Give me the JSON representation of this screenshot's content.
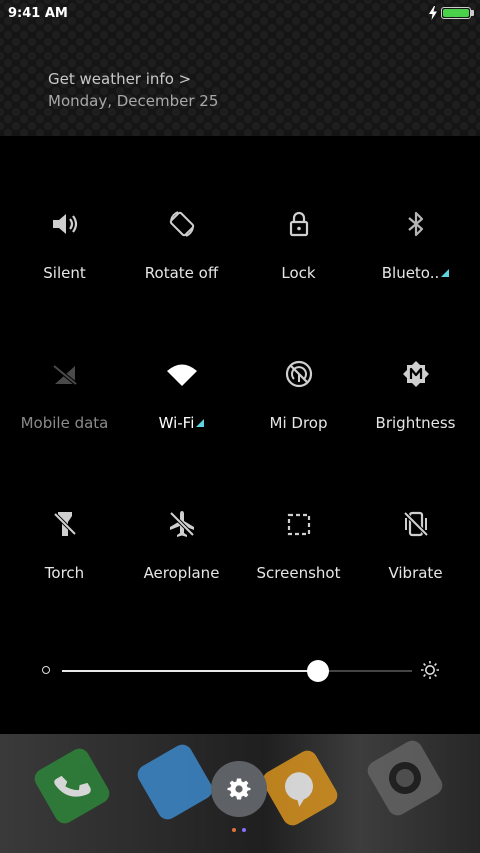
{
  "status_bar": {
    "time": "9:41 AM",
    "battery_level": 1.0
  },
  "header": {
    "weather_link": "Get weather info >",
    "date": "Monday, December 25"
  },
  "toggles": [
    {
      "label": "Silent",
      "icon": "speaker-icon"
    },
    {
      "label": "Rotate off",
      "icon": "rotate-icon"
    },
    {
      "label": "Lock",
      "icon": "lock-icon"
    },
    {
      "label": "Blueto..",
      "icon": "bluetooth-icon",
      "has_submenu": true
    },
    {
      "label": "Mobile data",
      "icon": "mobile-data-off-icon",
      "disabled": true
    },
    {
      "label": "Wi-Fi",
      "icon": "wifi-icon",
      "active": true,
      "has_submenu": true
    },
    {
      "label": "Mi Drop",
      "icon": "mi-drop-icon"
    },
    {
      "label": "Brightness",
      "icon": "auto-brightness-icon"
    },
    {
      "label": "Torch",
      "icon": "torch-icon"
    },
    {
      "label": "Aeroplane",
      "icon": "airplane-icon"
    },
    {
      "label": "Screenshot",
      "icon": "screenshot-icon"
    },
    {
      "label": "Vibrate",
      "icon": "vibrate-icon"
    }
  ],
  "brightness": {
    "level": 0.73
  },
  "colors": {
    "background": "#000000",
    "submenu_indicator": "#5fd3e0",
    "battery": "#4bd24b",
    "settings_button": "#5e6266",
    "page_dot_active": "#8a6cff",
    "page_dot_inactive": "#e2703a"
  },
  "dock": {
    "settings_icon": "gear-icon"
  }
}
